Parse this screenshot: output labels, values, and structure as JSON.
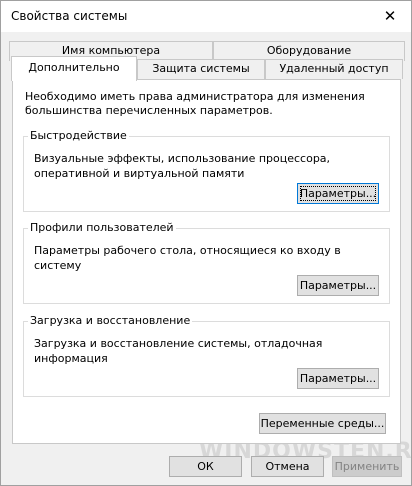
{
  "window": {
    "title": "Свойства системы",
    "close_glyph": "✕"
  },
  "tabs": {
    "row1": [
      {
        "label": "Имя компьютера"
      },
      {
        "label": "Оборудование"
      }
    ],
    "row2": [
      {
        "label": "Дополнительно",
        "active": true
      },
      {
        "label": "Защита системы"
      },
      {
        "label": "Удаленный доступ"
      }
    ]
  },
  "panel": {
    "intro": "Необходимо иметь права администратора для изменения большинства перечисленных параметров.",
    "groups": [
      {
        "title": "Быстродействие",
        "description": "Визуальные эффекты, использование процессора, оперативной и виртуальной памяти",
        "button": "Параметры..."
      },
      {
        "title": "Профили пользователей",
        "description": "Параметры рабочего стола, относящиеся ко входу в систему",
        "button": "Параметры..."
      },
      {
        "title": "Загрузка и восстановление",
        "description": "Загрузка и восстановление системы, отладочная информация",
        "button": "Параметры..."
      }
    ],
    "env_button": "Переменные среды..."
  },
  "footer": {
    "ok": "ОК",
    "cancel": "Отмена",
    "apply": "Применить"
  },
  "watermark": "WINDOWSTEN.RU"
}
